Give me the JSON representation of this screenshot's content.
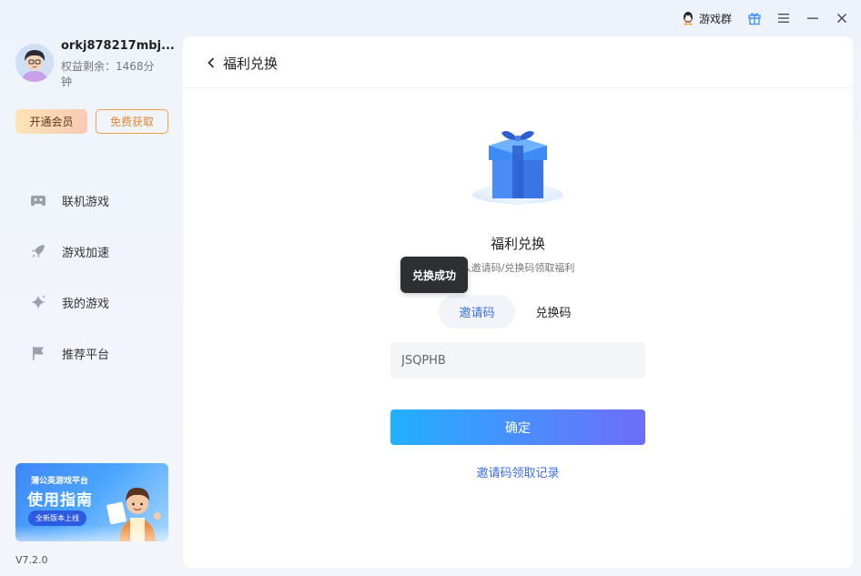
{
  "titlebar": {
    "group_label": "游戏群",
    "icons": [
      "qq-icon",
      "gift-icon",
      "menu-icon",
      "minimize-icon",
      "close-icon"
    ]
  },
  "user": {
    "name": "orkj878217mbj...",
    "quota": "权益剩余：1468分钟"
  },
  "sidebar": {
    "vip_label": "开通会员",
    "free_label": "免费获取",
    "items": [
      {
        "label": "联机游戏",
        "icon": "gamepad-icon"
      },
      {
        "label": "游戏加速",
        "icon": "rocket-icon"
      },
      {
        "label": "我的游戏",
        "icon": "sparkle-icon"
      },
      {
        "label": "推荐平台",
        "icon": "flag-icon"
      }
    ],
    "banner": {
      "line1": "蒲公英游戏平台",
      "line2": "使用指南",
      "badge": "全新版本上线"
    },
    "version": "V7.2.0"
  },
  "main": {
    "header_title": "福利兑换",
    "card_title": "福利兑换",
    "card_subtitle": "入邀请码/兑换码领取福利",
    "tabs": [
      {
        "label": "邀请码",
        "active": true
      },
      {
        "label": "兑换码",
        "active": false
      }
    ],
    "code_value": "JSQPHB",
    "confirm_label": "确定",
    "record_link": "邀请码领取记录"
  },
  "toast": {
    "text": "兑换成功"
  },
  "colors": {
    "accent": "#3a6ee8",
    "confirm_gradient_start": "#22b0ff",
    "confirm_gradient_end": "#6f6dfb",
    "free_orange": "#e8862a",
    "toast_bg": "#2e2f33"
  }
}
